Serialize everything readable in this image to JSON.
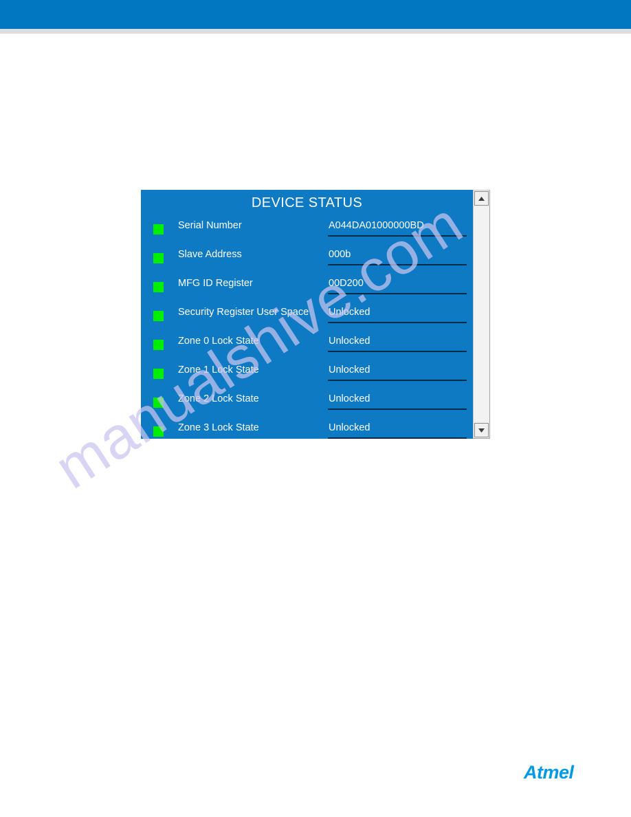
{
  "page": {
    "header_band_color": "#0077c0",
    "header_rule_color": "#dcdedf",
    "background_color": "#ffffff"
  },
  "watermark": {
    "text": "manualshive.com",
    "color": "#c9c6ef"
  },
  "figure": {
    "panel": {
      "title": "DEVICE STATUS",
      "background_color": "#0e7ac4",
      "title_color": "#ffffff",
      "led_color": "#00ee00",
      "underline_color": "#0b2a4a",
      "rows": [
        {
          "label": "Serial Number",
          "value": "A044DA01000000BD",
          "led": "green"
        },
        {
          "label": "Slave Address",
          "value": "000b",
          "led": "green"
        },
        {
          "label": "MFG ID Register",
          "value": "00D200",
          "led": "green"
        },
        {
          "label": "Security Register User Space",
          "value": "Unlocked",
          "led": "green"
        },
        {
          "label": "Zone 0 Lock State",
          "value": "Unlocked",
          "led": "green"
        },
        {
          "label": "Zone 1 Lock State",
          "value": "Unlocked",
          "led": "green"
        },
        {
          "label": "Zone 2 Lock State",
          "value": "Unlocked",
          "led": "green"
        },
        {
          "label": "Zone 3 Lock State",
          "value": "Unlocked",
          "led": "green"
        }
      ]
    },
    "scrollbar": {
      "up_arrow": "triangle-up-icon",
      "down_arrow": "triangle-down-icon",
      "track_color": "#f2f2f2"
    }
  },
  "footer": {
    "logo_text": "Atmel",
    "logo_color": "#0099e5"
  }
}
